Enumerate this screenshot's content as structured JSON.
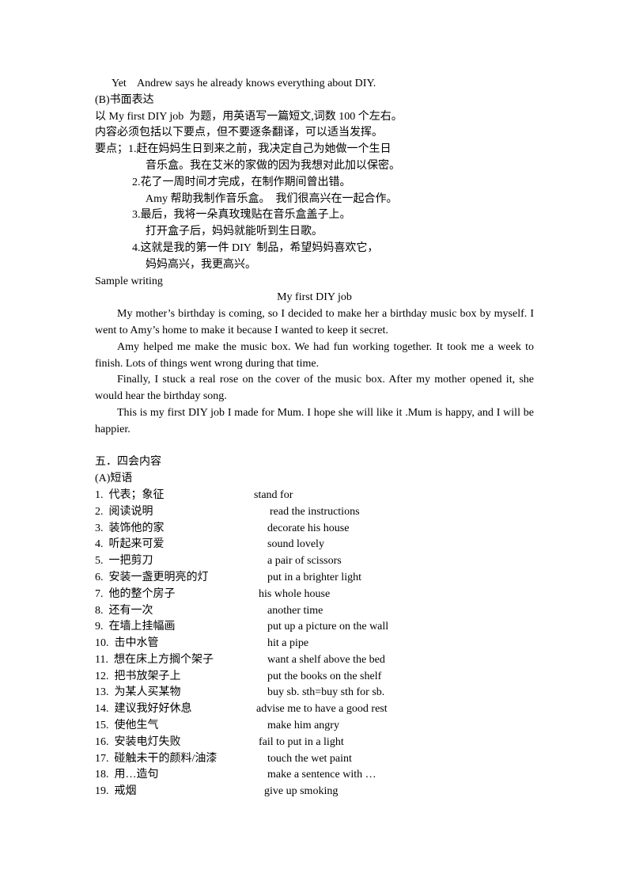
{
  "top_line": "Yet    Andrew says he already knows everything about DIY.",
  "section_b": {
    "heading": "(B)书面表达",
    "instructions": [
      "以 My first DIY job  为题，用英语写一篇短文,词数 100 个左右。",
      "内容必须包括以下要点，但不要逐条翻译，可以适当发挥。"
    ],
    "points": [
      {
        "text": "要点；1.赶在妈妈生日到来之前，我决定自己为她做一个生日",
        "indent": 0
      },
      {
        "text": "音乐盒。我在艾米的家做的因为我想对此加以保密。",
        "indent": 2
      },
      {
        "text": "2.花了一周时间才完成，在制作期间曾出错。",
        "indent": 1
      },
      {
        "text": "Amy 帮助我制作音乐盒。  我们很高兴在一起合作。",
        "indent": 2
      },
      {
        "text": "3.最后，我将一朵真玫瑰贴在音乐盒盖子上。",
        "indent": 1
      },
      {
        "text": "打开盒子后，妈妈就能听到生日歌。",
        "indent": 2
      },
      {
        "text": "4.这就是我的第一件 DIY  制品，希望妈妈喜欢它，",
        "indent": 1
      },
      {
        "text": "妈妈高兴，我更高兴。",
        "indent": 2
      }
    ],
    "sample_label": "Sample writing",
    "sample_title": "My first DIY job",
    "sample_paragraphs": [
      "My mother’s birthday is coming, so I decided to make her a birthday music box by myself. I went to Amy’s home to make it because I wanted to keep it secret.",
      "Amy helped me make the music box. We had fun working together. It took me a week to finish. Lots of things went wrong during that time.",
      "Finally, I stuck a real rose on the cover of the music box. After my mother opened it, she would hear the birthday song.",
      "This is my first DIY job I made for Mum. I hope she will like it .Mum is happy, and I will be happier."
    ]
  },
  "section_5": {
    "heading": "五．四会内容",
    "sub_heading": "(A)短语",
    "phrases": [
      {
        "cn": "1.  代表；象征",
        "en": "stand for"
      },
      {
        "cn": "2.  阅读说明",
        "en": "read the instructions"
      },
      {
        "cn": "3.  装饰他的家",
        "en": "decorate his house"
      },
      {
        "cn": "4.  听起来可爱",
        "en": "sound lovely"
      },
      {
        "cn": "5.  一把剪刀",
        "en": "a pair of scissors"
      },
      {
        "cn": "6.  安装一盏更明亮的灯",
        "en": "put in a brighter light"
      },
      {
        "cn": "7.  他的整个房子",
        "en": "his whole house"
      },
      {
        "cn": "8.  还有一次",
        "en": "another time"
      },
      {
        "cn": "9.  在墙上挂幅画",
        "en": "put up a picture on the wall"
      },
      {
        "cn": "10.  击中水管",
        "en": "hit a pipe"
      },
      {
        "cn": "11.  想在床上方搁个架子",
        "en": "want a shelf above the bed"
      },
      {
        "cn": "12.  把书放架子上",
        "en": "put the books on the shelf"
      },
      {
        "cn": "13.  为某人买某物",
        "en": "buy sb. sth=buy sth for sb."
      },
      {
        "cn": "14.  建议我好好休息",
        "en": "advise me to have a good rest"
      },
      {
        "cn": "15.  使他生气",
        "en": "make him angry"
      },
      {
        "cn": "16.  安装电灯失败",
        "en": "fail to put in a light"
      },
      {
        "cn": "17.  碰触未干的颜料/油漆",
        "en": "touch the wet paint"
      },
      {
        "cn": "18.  用…造句",
        "en": "make a sentence with …"
      },
      {
        "cn": "19.  戒烟",
        "en": "give up smoking"
      }
    ]
  }
}
